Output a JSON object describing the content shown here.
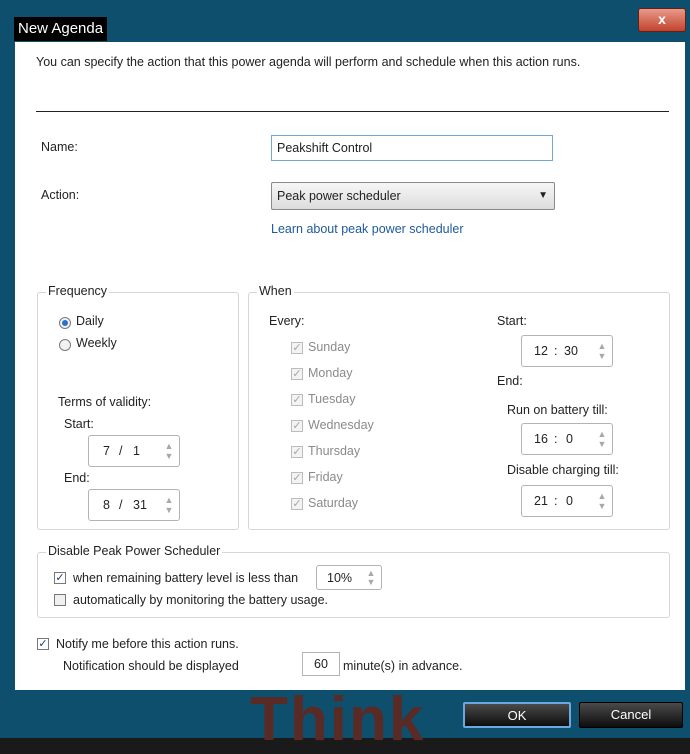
{
  "window": {
    "title": "New Agenda",
    "close_glyph": "x"
  },
  "intro": "You can specify the action that this power agenda will perform and schedule when this action runs.",
  "name": {
    "label": "Name:",
    "value": "Peakshift Control"
  },
  "action": {
    "label": "Action:",
    "value": "Peak power scheduler"
  },
  "learn_link": "Learn about peak power scheduler",
  "frequency": {
    "title": "Frequency",
    "daily": "Daily",
    "weekly": "Weekly",
    "selected": "Daily",
    "validity_label": "Terms of validity:",
    "start_label": "Start:",
    "start_month": "7",
    "start_day": "1",
    "end_label": "End:",
    "end_month": "8",
    "end_day": "31",
    "separator": "/"
  },
  "when": {
    "title": "When",
    "every_label": "Every:",
    "days": [
      "Sunday",
      "Monday",
      "Tuesday",
      "Wednesday",
      "Thursday",
      "Friday",
      "Saturday"
    ],
    "start_label": "Start:",
    "start_hour": "12",
    "start_min": "30",
    "end_label": "End:",
    "battery_label": "Run on battery till:",
    "battery_hour": "16",
    "battery_min": "0",
    "charging_label": "Disable charging till:",
    "charging_hour": "21",
    "charging_min": "0",
    "colon": ":"
  },
  "disable": {
    "title": "Disable Peak Power Scheduler",
    "remaining_label": "when remaining battery level is less than",
    "remaining_checked": true,
    "level": "10%",
    "monitor_label": "automatically by monitoring the battery usage.",
    "monitor_checked": false
  },
  "notify": {
    "label": "Notify me before this action runs.",
    "checked": true,
    "display_label": "Notification should be displayed",
    "minutes": "60",
    "suffix": "minute(s) in advance."
  },
  "buttons": {
    "ok": "OK",
    "cancel": "Cancel"
  },
  "watermark": "Think",
  "icons": {
    "check": "check-icon",
    "spin": "spin-arrows-icon",
    "dropdown": "dropdown-arrow-icon"
  }
}
